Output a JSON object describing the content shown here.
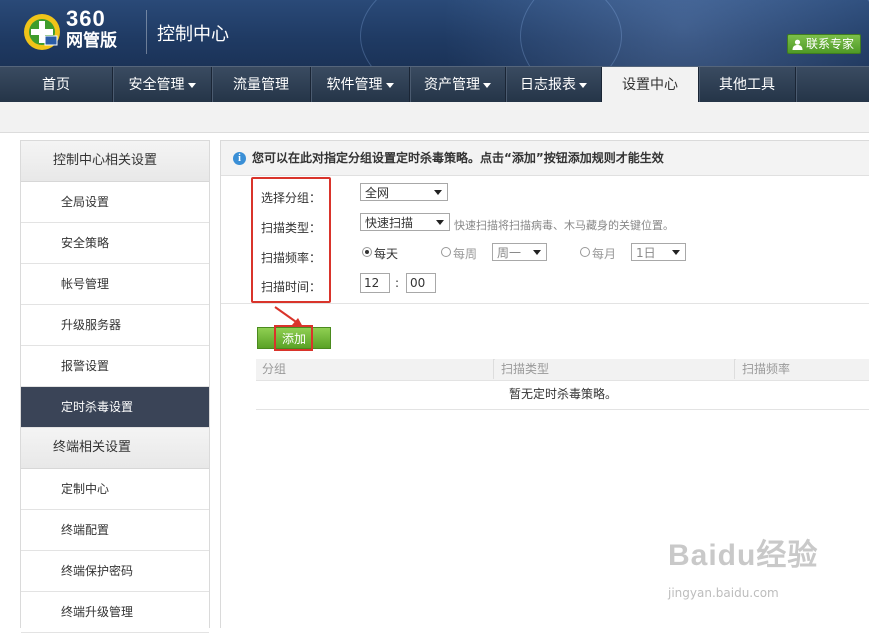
{
  "header": {
    "logo_number": "360",
    "logo_subtitle": "网管版",
    "app_title": "控制中心",
    "contact_label": "联系专家"
  },
  "nav": {
    "items": [
      {
        "label": "首页",
        "dropdown": false
      },
      {
        "label": "安全管理",
        "dropdown": true
      },
      {
        "label": "流量管理",
        "dropdown": false
      },
      {
        "label": "软件管理",
        "dropdown": true
      },
      {
        "label": "资产管理",
        "dropdown": true
      },
      {
        "label": "日志报表",
        "dropdown": true
      },
      {
        "label": "设置中心",
        "dropdown": false,
        "active": true
      },
      {
        "label": "其他工具",
        "dropdown": false
      }
    ]
  },
  "sidebar": {
    "section1_title": "控制中心相关设置",
    "section1_items": [
      "全局设置",
      "安全策略",
      "帐号管理",
      "升级服务器",
      "报警设置",
      "定时杀毒设置"
    ],
    "section2_title": "终端相关设置",
    "section2_items": [
      "定制中心",
      "终端配置",
      "终端保护密码",
      "终端升级管理"
    ],
    "active_item": "定时杀毒设置"
  },
  "main": {
    "info_text": "您可以在此对指定分组设置定时杀毒策略。点击“添加”按钮添加规则才能生效",
    "form": {
      "group_label": "选择分组：",
      "group_value": "全网",
      "scan_type_label": "扫描类型：",
      "scan_type_value": "快速扫描",
      "scan_type_hint": "快速扫描将扫描病毒、木马藏身的关键位置。",
      "freq_label": "扫描频率：",
      "freq_daily": "每天",
      "freq_weekly": "每周",
      "freq_weekly_value": "周一",
      "freq_monthly": "每月",
      "freq_monthly_value": "1日",
      "freq_selected": "每天",
      "time_label": "扫描时间：",
      "time_hour": "12",
      "time_sep": ":",
      "time_minute": "00"
    },
    "add_button": "添加",
    "table": {
      "columns": [
        "分组",
        "扫描类型",
        "扫描频率"
      ],
      "empty_text": "暂无定时杀毒策略。"
    }
  },
  "watermark": {
    "main": "Baidu经验",
    "sub": "jingyan.baidu.com"
  },
  "colors": {
    "header_bg": "#1f3a63",
    "nav_bg": "#2c3c51",
    "accent_green": "#5aa226",
    "highlight_red": "#d9342b",
    "sidebar_active": "#3a4457"
  }
}
